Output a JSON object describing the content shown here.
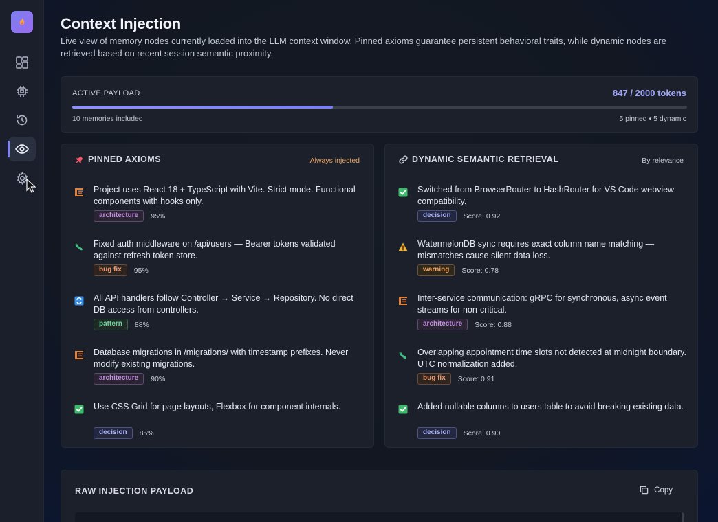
{
  "page": {
    "title": "Context Injection",
    "description": "Live view of memory nodes currently loaded into the LLM context window. Pinned axioms guarantee persistent behavioral traits, while dynamic nodes are retrieved based on recent session semantic proximity."
  },
  "sidebar": {
    "items": [
      {
        "name": "dashboard",
        "icon": "dashboard-icon",
        "active": false
      },
      {
        "name": "memory",
        "icon": "chip-icon",
        "active": false
      },
      {
        "name": "history",
        "icon": "history-icon",
        "active": false
      },
      {
        "name": "context",
        "icon": "eye-icon",
        "active": true
      },
      {
        "name": "settings",
        "icon": "gear-icon",
        "active": false
      }
    ]
  },
  "payload": {
    "label": "ACTIVE PAYLOAD",
    "tokens": "847 / 2000 tokens",
    "progress_fraction": 0.4235,
    "memories": "10 memories included",
    "split": "5 pinned • 5 dynamic"
  },
  "pinned": {
    "title": "PINNED AXIOMS",
    "meta": "Always injected",
    "items": [
      {
        "icon": "architecture-icon",
        "text": "Project uses React 18 + TypeScript with Vite. Strict mode. Functional components with hooks only.",
        "tag": "architecture",
        "score": "95%"
      },
      {
        "icon": "bug-icon",
        "text": "Fixed auth middleware on /api/users — Bearer tokens validated against refresh token store.",
        "tag": "bug fix",
        "score": "95%"
      },
      {
        "icon": "pattern-icon",
        "text": "All API handlers follow Controller → Service → Repository. No direct DB access from controllers.",
        "tag": "pattern",
        "score": "88%"
      },
      {
        "icon": "architecture-icon",
        "text": "Database migrations in /migrations/ with timestamp prefixes. Never modify existing migrations.",
        "tag": "architecture",
        "score": "90%"
      },
      {
        "icon": "check-icon",
        "text": "Use CSS Grid for page layouts, Flexbox for component internals.",
        "tag": "decision",
        "score": "85%"
      }
    ]
  },
  "dynamic": {
    "title": "DYNAMIC SEMANTIC RETRIEVAL",
    "meta": "By relevance",
    "items": [
      {
        "icon": "check-icon",
        "text": "Switched from BrowserRouter to HashRouter for VS Code webview compatibility.",
        "tag": "decision",
        "score": "Score: 0.92"
      },
      {
        "icon": "warning-icon",
        "text": "WatermelonDB sync requires exact column name matching — mismatches cause silent data loss.",
        "tag": "warning",
        "score": "Score: 0.78"
      },
      {
        "icon": "architecture-icon",
        "text": "Inter-service communication: gRPC for synchronous, async event streams for non-critical.",
        "tag": "architecture",
        "score": "Score: 0.88"
      },
      {
        "icon": "bug-icon",
        "text": "Overlapping appointment time slots not detected at midnight boundary. UTC normalization added.",
        "tag": "bug fix",
        "score": "Score: 0.91"
      },
      {
        "icon": "check-icon",
        "text": "Added nullable columns to users table to avoid breaking existing data.",
        "tag": "decision",
        "score": "Score: 0.90"
      }
    ]
  },
  "raw": {
    "title": "RAW INJECTION PAYLOAD",
    "copy_label": "Copy"
  },
  "colors": {
    "accent": "#7d82f5",
    "always_injected": "#f0a45a"
  }
}
